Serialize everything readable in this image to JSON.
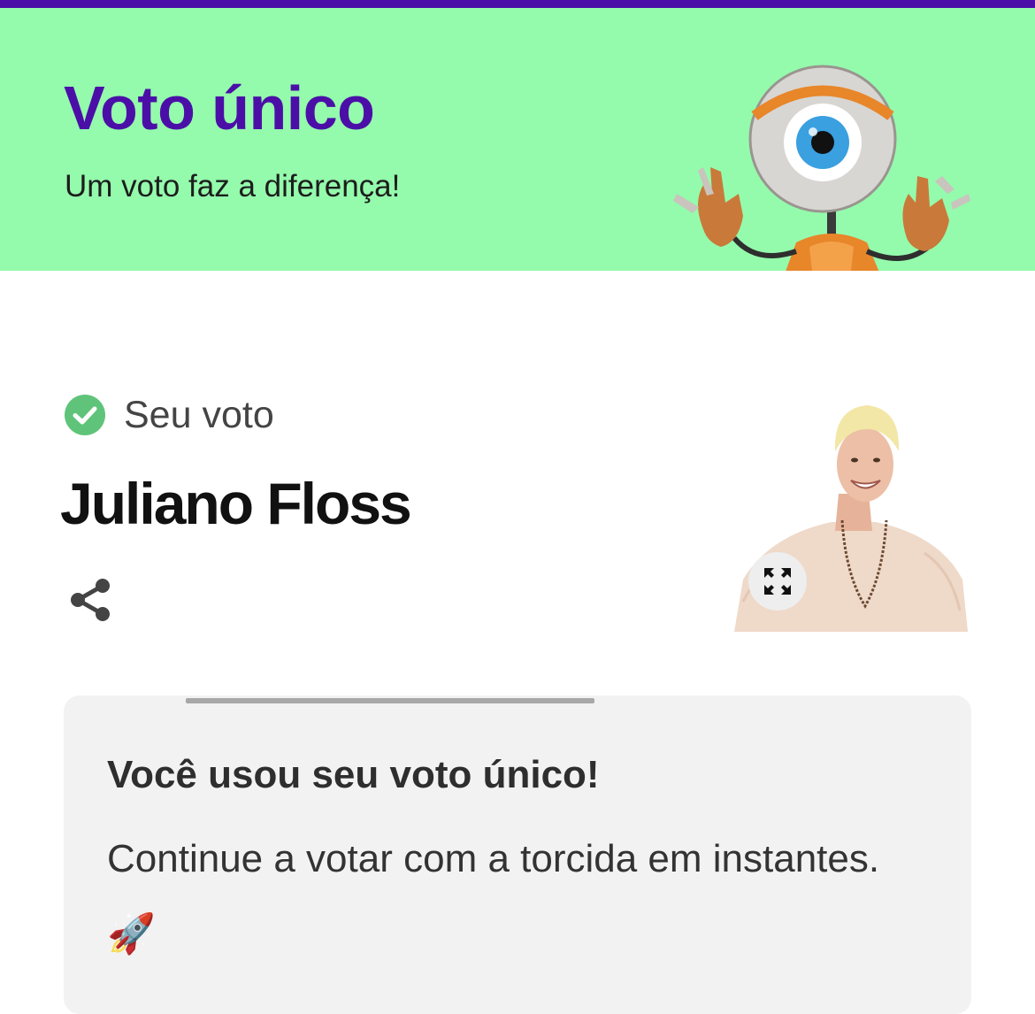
{
  "banner": {
    "title": "Voto único",
    "subtitle": "Um voto faz a diferença!",
    "mascot_icon": "big-brother-eye-robot"
  },
  "vote": {
    "status_label": "Seu voto",
    "status_icon": "check-circle-icon",
    "candidate_name": "Juliano Floss",
    "share_icon": "share-icon",
    "expand_icon": "expand-icon"
  },
  "card": {
    "title": "Você usou seu voto único!",
    "text": "Continue a votar com a torcida em instantes. 🚀"
  },
  "colors": {
    "brand_purple": "#4b0fa8",
    "banner_green": "#94fbac",
    "check_green": "#5fc47a",
    "card_bg": "#f2f2f2"
  }
}
